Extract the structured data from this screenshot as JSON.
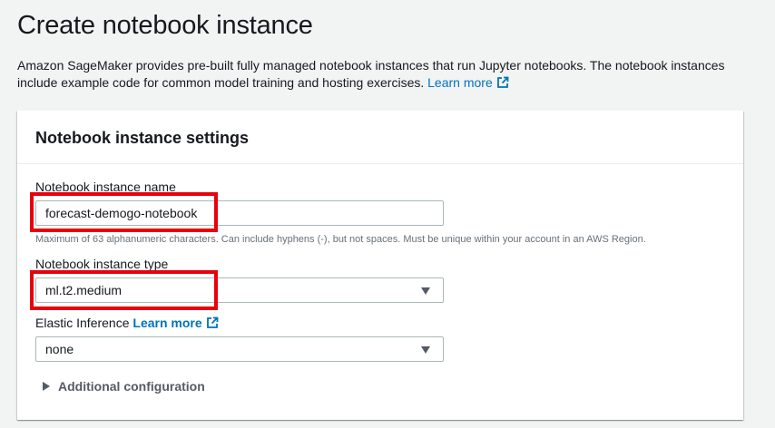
{
  "page": {
    "title": "Create notebook instance",
    "description": "Amazon SageMaker provides pre-built fully managed notebook instances that run Jupyter notebooks. The notebook instances include example code for common model training and hosting exercises.",
    "learn_more": "Learn more"
  },
  "settings": {
    "title": "Notebook instance settings",
    "name_label": "Notebook instance name",
    "name_value": "forecast-demogo-notebook",
    "name_hint": "Maximum of 63 alphanumeric characters. Can include hyphens (-), but not spaces. Must be unique within your account in an AWS Region.",
    "type_label": "Notebook instance type",
    "type_value": "ml.t2.medium",
    "elastic_label": "Elastic Inference",
    "elastic_learn_more": "Learn more",
    "elastic_value": "none",
    "additional_config": "Additional configuration"
  },
  "colors": {
    "link": "#0073bb",
    "highlight": "#e8000b",
    "background": "#f2f3f3"
  },
  "icons": [
    "external-link-icon",
    "caret-down-icon",
    "caret-right-icon"
  ]
}
